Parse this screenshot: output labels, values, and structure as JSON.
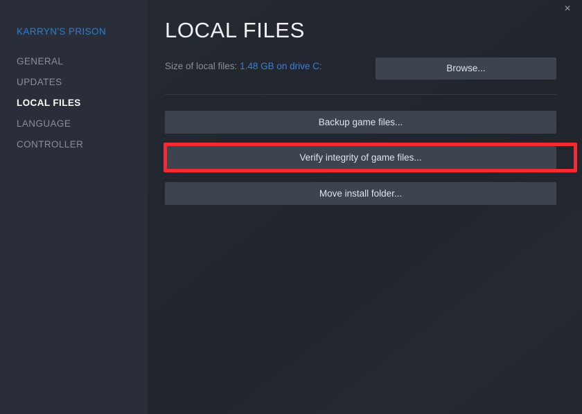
{
  "window": {
    "close_icon": "×"
  },
  "sidebar": {
    "app_title": "KARRYN'S PRISON",
    "items": [
      {
        "label": "GENERAL",
        "active": false
      },
      {
        "label": "UPDATES",
        "active": false
      },
      {
        "label": "LOCAL FILES",
        "active": true
      },
      {
        "label": "LANGUAGE",
        "active": false
      },
      {
        "label": "CONTROLLER",
        "active": false
      }
    ]
  },
  "main": {
    "page_title": "LOCAL FILES",
    "size_label": "Size of local files:",
    "size_value": "1.48 GB on drive C:",
    "browse_label": "Browse...",
    "actions": [
      {
        "label": "Backup game files..."
      },
      {
        "label": "Verify integrity of game files..."
      },
      {
        "label": "Move install folder..."
      }
    ]
  },
  "colors": {
    "accent_blue": "#3d7fd9",
    "app_title_blue": "#2a7fd4",
    "highlight_red": "#f42a34",
    "panel_bg": "#22262e",
    "sidebar_bg": "#2a2e38",
    "button_bg": "#3d4450"
  }
}
